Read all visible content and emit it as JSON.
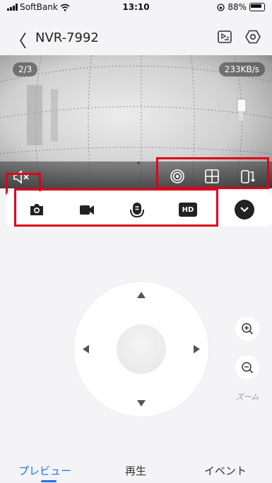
{
  "status_bar": {
    "carrier": "SoftBank",
    "time": "13:10",
    "battery": "88%"
  },
  "nav": {
    "back_glyph": "〈",
    "title": "NVR-7992",
    "icons": [
      "playlist-icon",
      "settings-hex-icon"
    ]
  },
  "video": {
    "page_indicator": "2/3",
    "bitrate": "233KB/s",
    "bottom_left_icons": [
      "mute-icon"
    ],
    "bottom_right_icons": [
      "fisheye-view-icon",
      "split-screen-icon",
      "rotate-phone-icon"
    ]
  },
  "toolbar": {
    "icons": [
      "snapshot-icon",
      "record-icon",
      "talk-icon",
      "hd-icon"
    ],
    "hd_label": "HD",
    "expand_icon": "chevron-down-icon"
  },
  "ptz": {
    "directions": [
      "up",
      "down",
      "left",
      "right"
    ]
  },
  "zoom": {
    "label": "ズーム",
    "icons": [
      "zoom-in-icon",
      "zoom-out-icon"
    ]
  },
  "tabs": [
    {
      "label": "プレビュー",
      "active": true
    },
    {
      "label": "再生",
      "active": false
    },
    {
      "label": "イベント",
      "active": false
    }
  ],
  "colors": {
    "accent": "#1a73e8",
    "highlight": "#e0001a"
  }
}
